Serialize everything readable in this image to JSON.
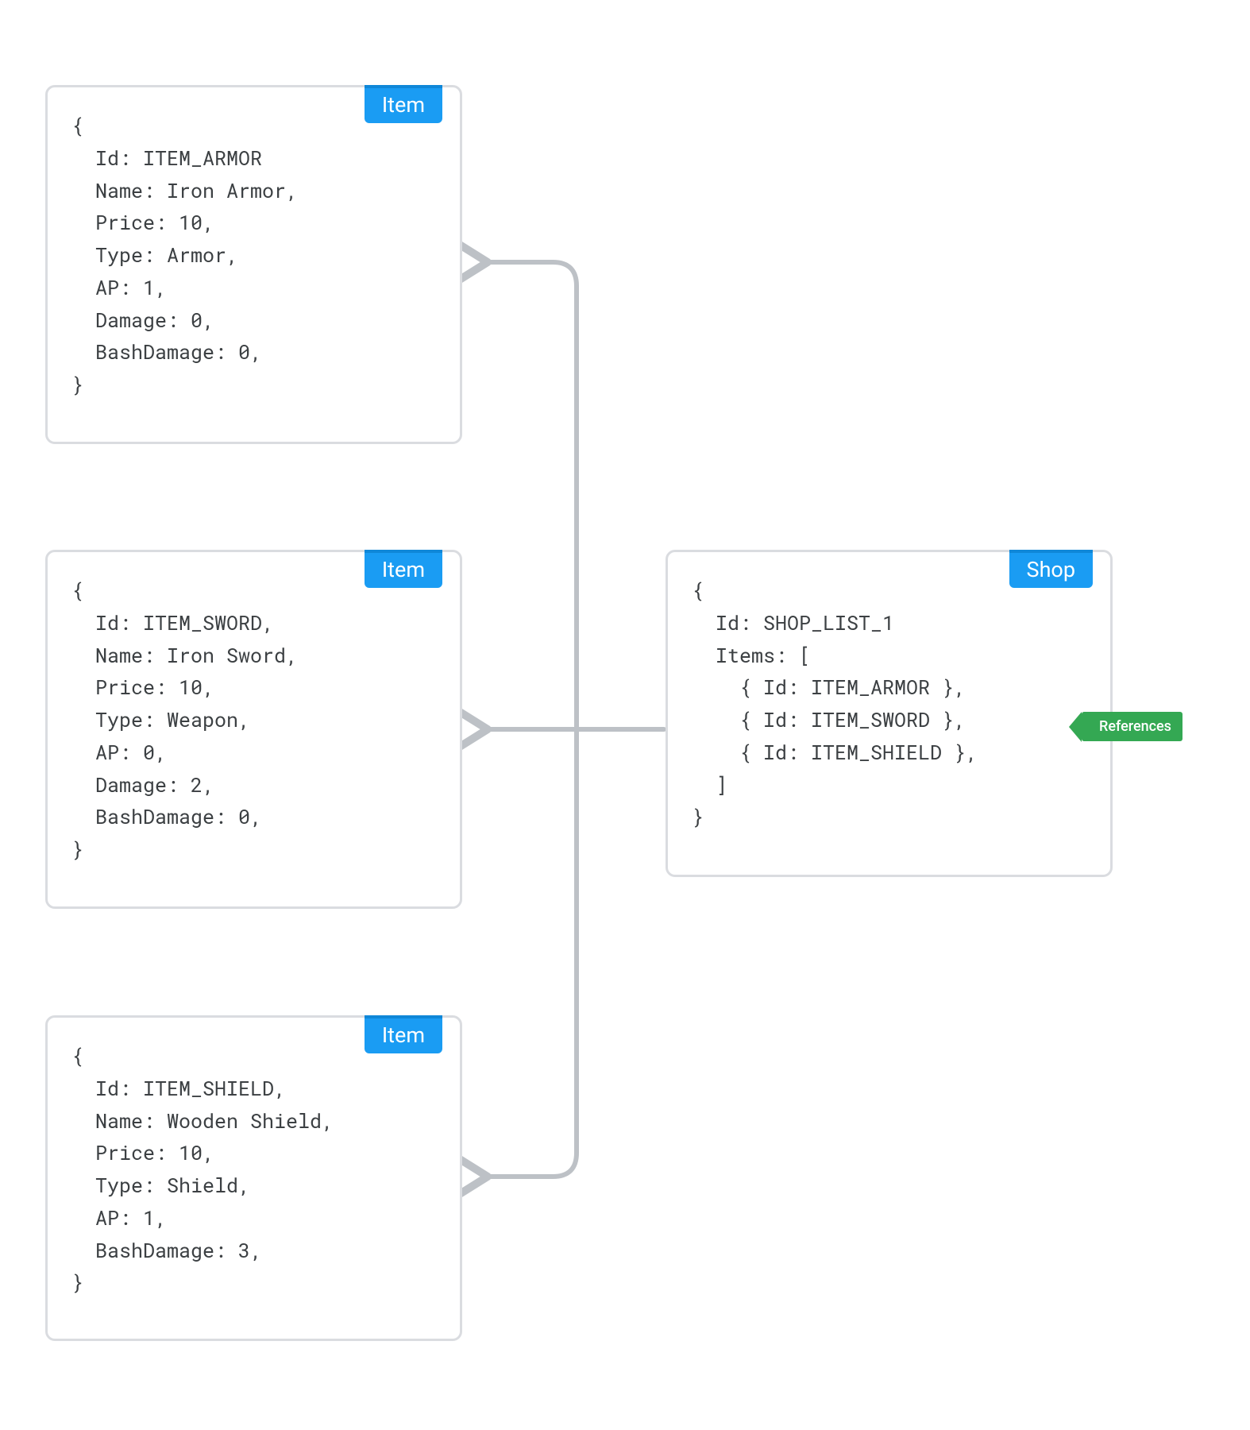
{
  "labels": {
    "item": "Item",
    "shop": "Shop",
    "references": "References"
  },
  "items": [
    {
      "code": "{\n  Id: ITEM_ARMOR\n  Name: Iron Armor,\n  Price: 10,\n  Type: Armor,\n  AP: 1,\n  Damage: 0,\n  BashDamage: 0,\n}"
    },
    {
      "code": "{\n  Id: ITEM_SWORD,\n  Name: Iron Sword,\n  Price: 10,\n  Type: Weapon,\n  AP: 0,\n  Damage: 2,\n  BashDamage: 0,\n}"
    },
    {
      "code": "{\n  Id: ITEM_SHIELD,\n  Name: Wooden Shield,\n  Price: 10,\n  Type: Shield,\n  AP: 1,\n  BashDamage: 3,\n}"
    }
  ],
  "shop": {
    "code": "{\n  Id: SHOP_LIST_1\n  Items: [\n    { Id: ITEM_ARMOR },\n    { Id: ITEM_SWORD },\n    { Id: ITEM_SHIELD },\n  ]\n}"
  }
}
